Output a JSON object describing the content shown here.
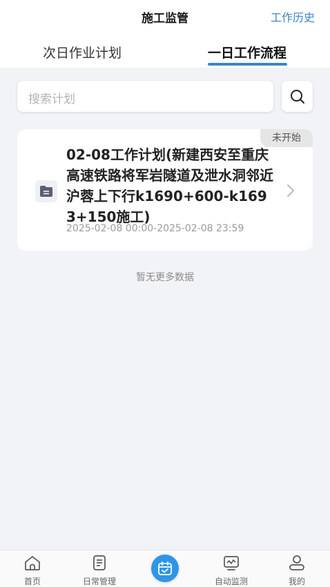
{
  "header": {
    "title": "施工监管",
    "history_link": "工作历史"
  },
  "tabs": [
    {
      "label": "次日作业计划",
      "active": false
    },
    {
      "label": "一日工作流程",
      "active": true
    }
  ],
  "search": {
    "placeholder": "搜索计划"
  },
  "plans": [
    {
      "status": "未开始",
      "title": "02-08工作计划(新建西安至重庆高速铁路将军岩隧道及泄水洞邻近沪蓉上下行k1690+600-k1693+150施工)",
      "time": "2025-02-08 00:00-2025-02-08 23:59"
    }
  ],
  "empty_message": "暂无更多数据",
  "bottom_nav": [
    {
      "label": "首页",
      "icon": "home-icon"
    },
    {
      "label": "日常管理",
      "icon": "document-icon"
    },
    {
      "label": "",
      "icon": "calendar-check-icon"
    },
    {
      "label": "自动监测",
      "icon": "monitor-icon"
    },
    {
      "label": "我的",
      "icon": "user-icon"
    }
  ],
  "colors": {
    "accent": "#3a86c8",
    "center_button": "#2f95e6",
    "background": "#f2f3f7"
  }
}
